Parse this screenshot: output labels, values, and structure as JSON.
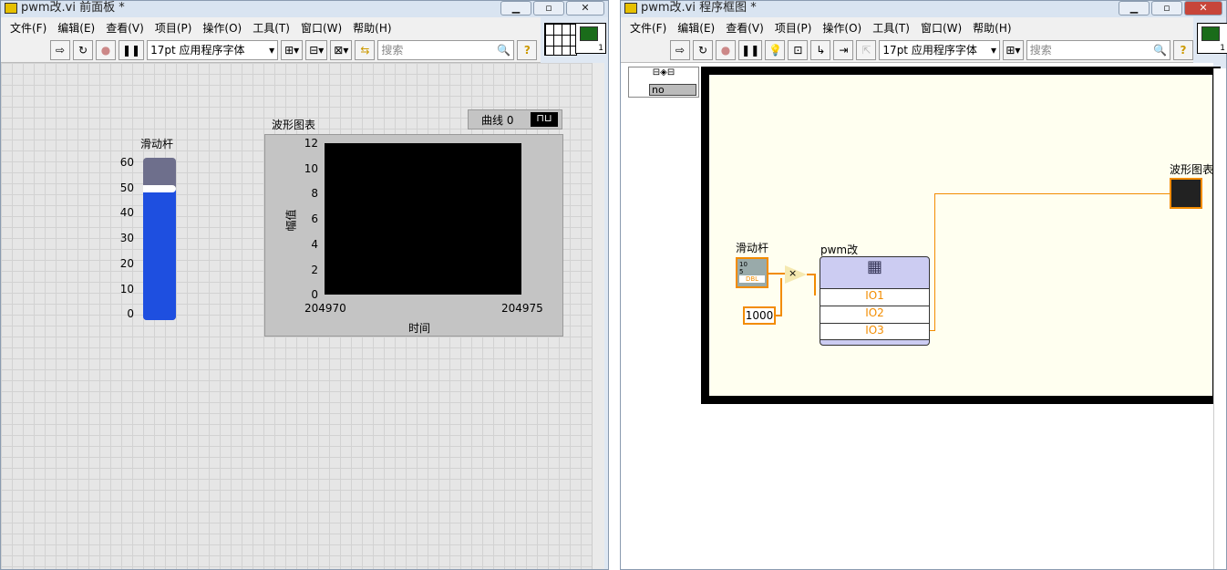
{
  "front_panel": {
    "title": "pwm改.vi 前面板 *",
    "menu": [
      "文件(F)",
      "编辑(E)",
      "查看(V)",
      "项目(P)",
      "操作(O)",
      "工具(T)",
      "窗口(W)",
      "帮助(H)"
    ],
    "font": "17pt 应用程序字体",
    "search_placeholder": "搜索",
    "connector_number": "1",
    "slider": {
      "label": "滑动杆",
      "ticks": [
        "60",
        "50",
        "40",
        "30",
        "20",
        "10",
        "0"
      ],
      "value": 50,
      "max": 60
    },
    "chart": {
      "label": "波形图表",
      "plot_legend": "曲线 0",
      "ylabel": "幅值",
      "xlabel": "时间",
      "yticks": [
        "12",
        "10",
        "8",
        "6",
        "4",
        "2",
        "0"
      ],
      "xticks": [
        "204970",
        "204975"
      ]
    }
  },
  "block_diagram": {
    "title": "pwm改.vi 程序框图 *",
    "menu": [
      "文件(F)",
      "编辑(E)",
      "查看(V)",
      "项目(P)",
      "操作(O)",
      "工具(T)",
      "窗口(W)",
      "帮助(H)"
    ],
    "font": "17pt 应用程序字体",
    "search_placeholder": "搜索",
    "connector_number": "1",
    "stop_value": "no",
    "slider_terminal": "滑动杆",
    "slider_ticks": [
      "10",
      "5"
    ],
    "dbl": "DBL",
    "constant": "1000",
    "multiply": "×",
    "subvi": {
      "label": "pwm改",
      "terminals": [
        "IO1",
        "IO2",
        "IO3"
      ]
    },
    "chart_terminal": "波形图表"
  },
  "colors": {
    "wire": "#f28c00",
    "slider_fill": "#1e4fe0",
    "loop_bg": "#fffff0"
  }
}
